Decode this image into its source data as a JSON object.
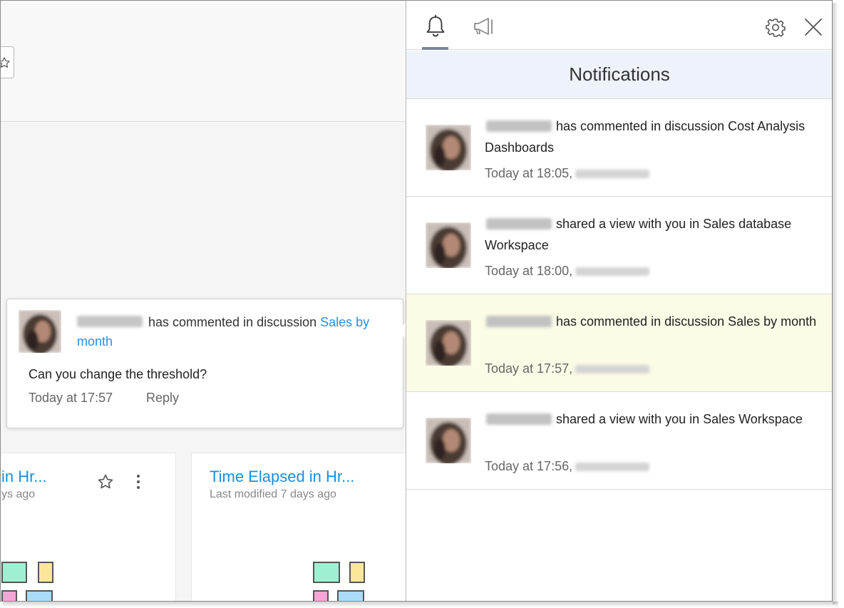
{
  "panel": {
    "heading": "Notifications",
    "tabs": [
      {
        "name": "notifications",
        "icon": "bell-icon",
        "active": true
      },
      {
        "name": "announcements",
        "icon": "megaphone-icon",
        "active": false
      }
    ],
    "actions": {
      "settings_icon": "gear-icon",
      "close_icon": "close-icon"
    }
  },
  "notifications": [
    {
      "message": "has commented in discussion Cost Analysis Dashboards",
      "time": "Today at 18:05,",
      "highlighted": false
    },
    {
      "message": "shared a view with you in Sales database Workspace",
      "time": "Today at 18:00,",
      "highlighted": false
    },
    {
      "message": "has commented in discussion Sales by month",
      "time": "Today at 17:57,",
      "highlighted": true
    },
    {
      "message": "shared a view with you in Sales Workspace",
      "time": "Today at 17:56,",
      "highlighted": false
    }
  ],
  "popover": {
    "message": "has commented in discussion",
    "link": "Sales by month",
    "comment": "Can you change the threshold?",
    "time": "Today at 17:57",
    "reply_label": "Reply"
  },
  "cards": [
    {
      "title": "in Hr...",
      "subtitle": "ys ago"
    },
    {
      "title": "Time Elapsed in Hr...",
      "subtitle": "Last modified 7 days ago"
    }
  ],
  "colors": {
    "accent_link": "#2f8ee0",
    "card_title": "#1a8fd6",
    "highlight_row": "#fbfbe6",
    "heading_bg": "#eef3fb"
  }
}
